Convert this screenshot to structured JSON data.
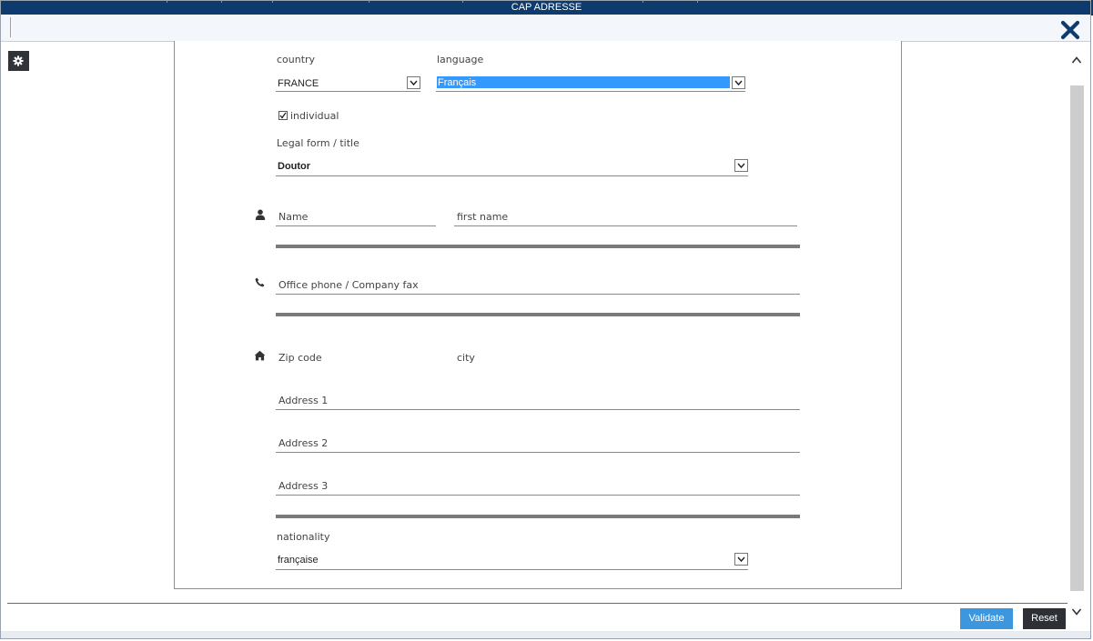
{
  "window": {
    "title": "CAP ADRESSE"
  },
  "form": {
    "country_label": "country",
    "country_value": "FRANCE",
    "language_label": "language",
    "language_value": "Français",
    "individual_label": "individual",
    "individual_checked": true,
    "legal_form_label": "Legal form / title",
    "legal_form_value": "Doutor",
    "name_placeholder": "Name",
    "first_name_placeholder": "first name",
    "phone_placeholder": "Office phone / Company fax",
    "zip_placeholder": "Zip code",
    "city_placeholder": "city",
    "address1_placeholder": "Address 1",
    "address2_placeholder": "Address 2",
    "address3_placeholder": "Address 3",
    "nationality_label": "nationality",
    "nationality_value": "française"
  },
  "footer": {
    "validate_label": "Validate",
    "reset_label": "Reset"
  },
  "colors": {
    "titlebar": "#0e3b6e",
    "selected_highlight": "#3399ff",
    "validate_button": "#3c97de",
    "reset_button": "#2d3035"
  },
  "icons": {
    "close": "close-icon",
    "settings": "gear-icon",
    "person": "person-icon",
    "phone": "phone-icon",
    "home": "home-icon",
    "scroll_up": "chevron-up-icon",
    "scroll_down": "chevron-down-icon"
  }
}
